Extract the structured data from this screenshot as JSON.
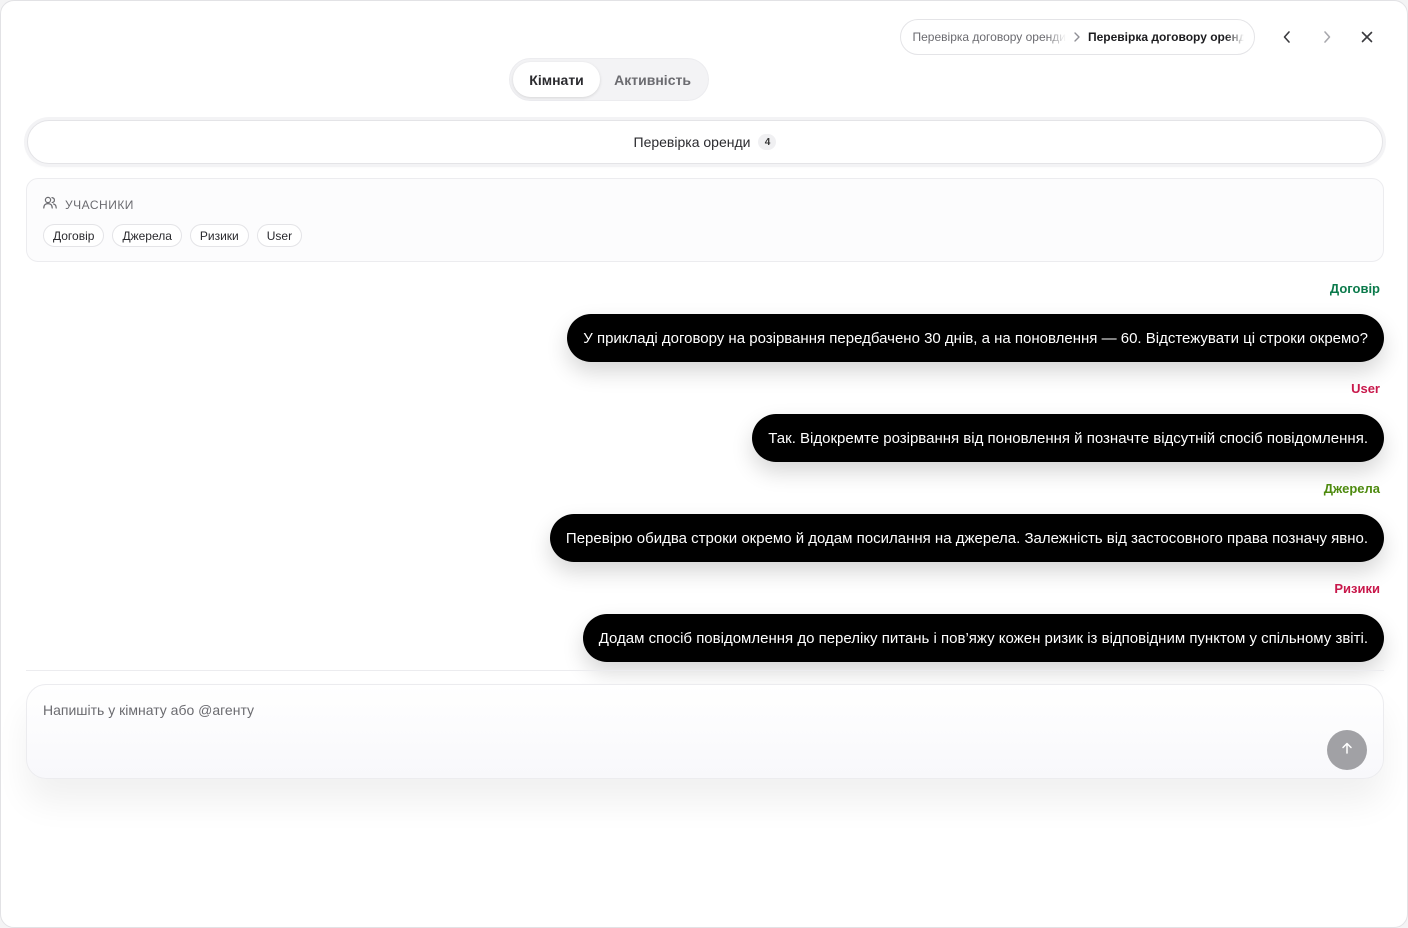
{
  "breadcrumb": {
    "items": [
      "Перевірка договору оренди",
      "Перевірка договору оренди"
    ]
  },
  "nav": {
    "back_icon": "chevron-left-icon",
    "forward_icon": "chevron-right-icon",
    "close_icon": "close-icon"
  },
  "tabs": [
    {
      "label": "Кімнати",
      "active": true
    },
    {
      "label": "Активність",
      "active": false
    }
  ],
  "room": {
    "name": "Перевірка оренди",
    "count": "4"
  },
  "participants": {
    "title": "УЧАСНИКИ",
    "icon": "users-icon",
    "chips": [
      "Договір",
      "Джерела",
      "Ризики",
      "User"
    ]
  },
  "messages": [
    {
      "author": "Договір",
      "color": "#0b7a4b",
      "text": "У прикладі договору на розірвання передбачено 30 днів, а на поновлення — 60. Відстежувати ці строки окремо?"
    },
    {
      "author": "User",
      "color": "#c8184b",
      "text": "Так. Відокремте розірвання від поновлення й позначте відсутній спосіб повідомлення."
    },
    {
      "author": "Джерела",
      "color": "#4d8a0e",
      "text": "Перевірю обидва строки окремо й додам посилання на джерела. Залежність від застосовного права позначу явно."
    },
    {
      "author": "Ризики",
      "color": "#c8184b",
      "text": "Додам спосіб повідомлення до переліку питань і пов’яжу кожен ризик із відповідним пунктом у спільному звіті."
    }
  ],
  "composer": {
    "placeholder": "Напишіть у кімнату або @агенту",
    "value": "",
    "send_icon": "arrow-up-icon"
  }
}
